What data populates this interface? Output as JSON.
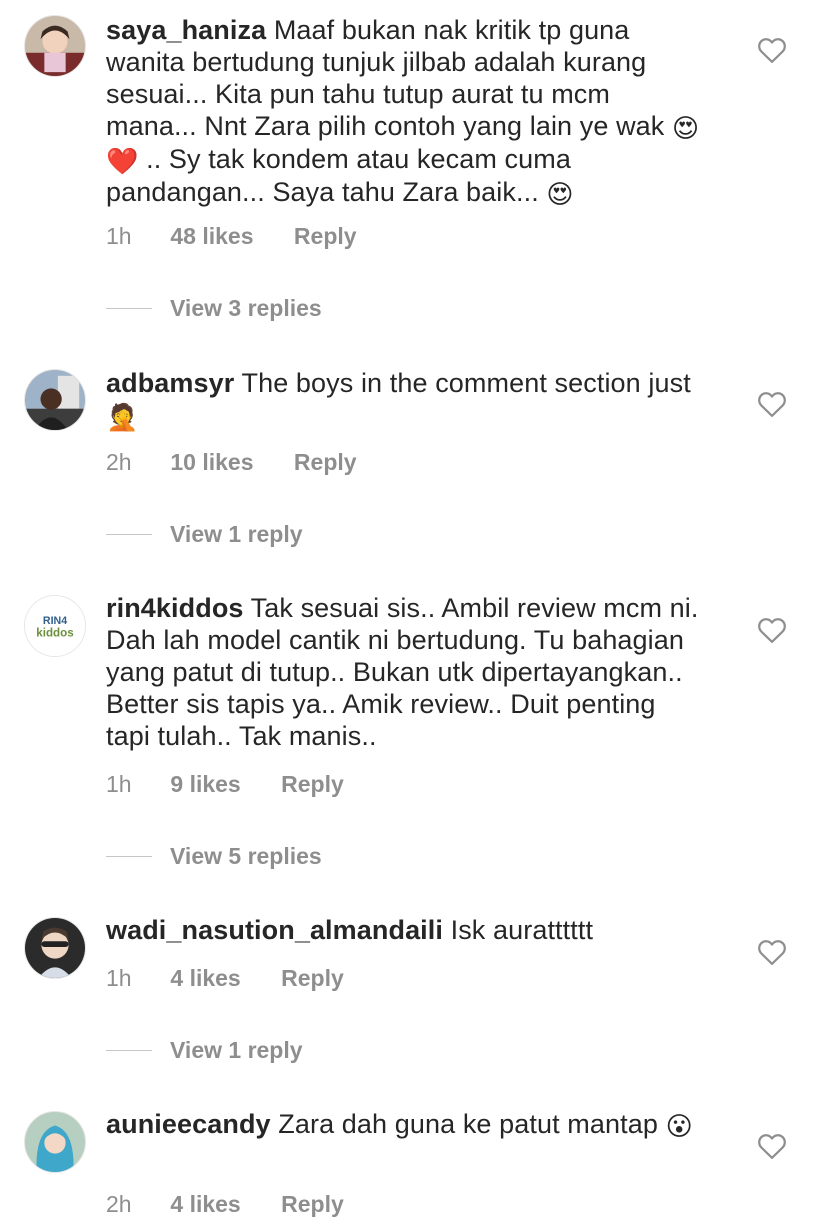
{
  "comments": [
    {
      "username": "saya_haniza",
      "text_1": "Maaf bukan nak kritik tp guna wanita bertudung tunjuk jilbab adalah kurang sesuai... Kita pun tahu tutup aurat tu mcm mana... Nnt Zara pilih contoh yang lain ye wak",
      "emoji_1": "😍",
      "emoji_2": "❤️",
      "text_2": ".. Sy tak kondem atau kecam cuma pandangan... Saya tahu Zara baik...",
      "emoji_3": "😍",
      "time": "1h",
      "likes": "48 likes",
      "reply": "Reply",
      "view_replies": "View 3 replies",
      "like_icon": "heart-outline-icon"
    },
    {
      "username": "adbamsyr",
      "text_1": "The boys in the comment section just",
      "emoji_1": "🤦",
      "time": "2h",
      "likes": "10 likes",
      "reply": "Reply",
      "view_replies": "View 1 reply",
      "like_icon": "heart-outline-icon"
    },
    {
      "username": "rin4kiddos",
      "avatar_logo_top": "RIN4",
      "avatar_logo_bottom": "kiddos",
      "text_1": "Tak sesuai sis.. Ambil review mcm ni. Dah lah model cantik ni bertudung. Tu bahagian yang patut di tutup.. Bukan utk dipertayangkan.. Better sis tapis ya.. Amik review.. Duit penting tapi tulah.. Tak manis..",
      "time": "1h",
      "likes": "9 likes",
      "reply": "Reply",
      "view_replies": "View 5 replies",
      "like_icon": "heart-outline-icon"
    },
    {
      "username": "wadi_nasution_almandaili",
      "text_1": "Isk auratttttt",
      "time": "1h",
      "likes": "4 likes",
      "reply": "Reply",
      "view_replies": "View 1 reply",
      "like_icon": "heart-outline-icon"
    },
    {
      "username": "aunieecandy",
      "text_1": "Zara dah guna ke patut mantap",
      "emoji_1": "😮",
      "time": "2h",
      "likes": "4 likes",
      "reply": "Reply",
      "like_icon": "heart-outline-icon"
    }
  ],
  "colors": {
    "text": "#262626",
    "secondary": "#8e8e8e",
    "divider": "#c7c7c7"
  }
}
